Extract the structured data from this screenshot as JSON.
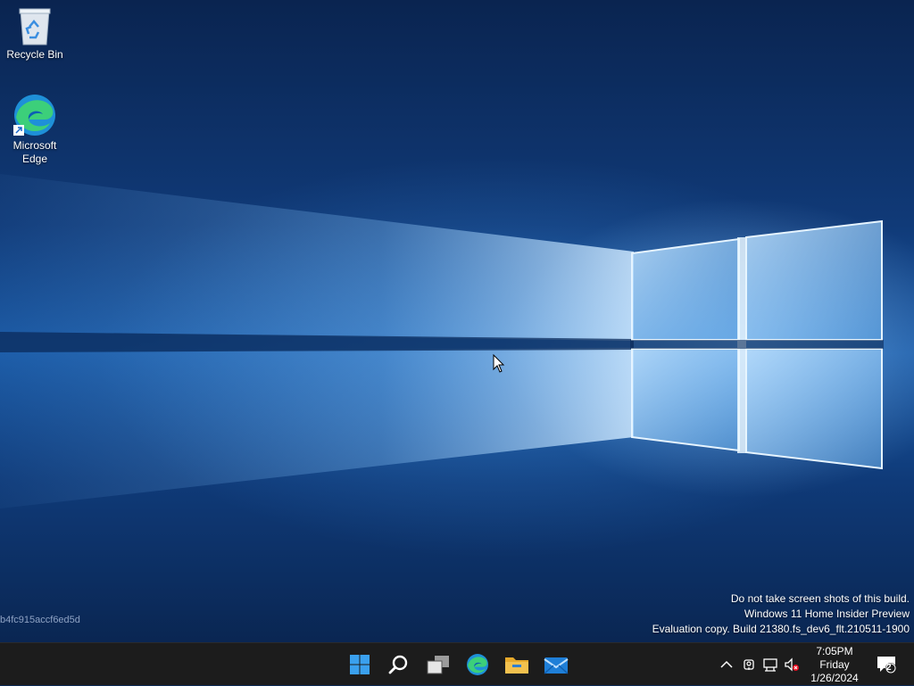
{
  "desktop": {
    "icons": [
      {
        "label": "Recycle Bin",
        "icon": "recycle-bin-icon"
      },
      {
        "label_line1": "Microsoft",
        "label_line2": "Edge",
        "icon": "edge-icon"
      }
    ],
    "hash_text": "b4fc915accf6ed5d",
    "watermark": {
      "line1": "Do not take screen shots of this build.",
      "line2": "Windows 11 Home Insider Preview",
      "line3": "Evaluation copy. Build 21380.fs_dev6_flt.210511-1900"
    }
  },
  "taskbar": {
    "pinned": [
      {
        "name": "start",
        "icon": "windows-logo-icon"
      },
      {
        "name": "search",
        "icon": "search-icon"
      },
      {
        "name": "task-view",
        "icon": "task-view-icon"
      },
      {
        "name": "edge",
        "icon": "edge-icon"
      },
      {
        "name": "file-explorer",
        "icon": "folder-icon"
      },
      {
        "name": "mail",
        "icon": "mail-icon"
      }
    ],
    "tray": {
      "icons": [
        "chevron-up-icon",
        "meet-now-icon",
        "network-icon",
        "volume-muted-icon"
      ],
      "clock": {
        "time": "7:05PM",
        "day": "Friday",
        "date": "1/26/2024"
      },
      "notification_count": "2"
    }
  },
  "colors": {
    "taskbar_bg": "#1c1c1c",
    "accent_blue": "#0078d4",
    "folder_yellow": "#f2c14e"
  }
}
